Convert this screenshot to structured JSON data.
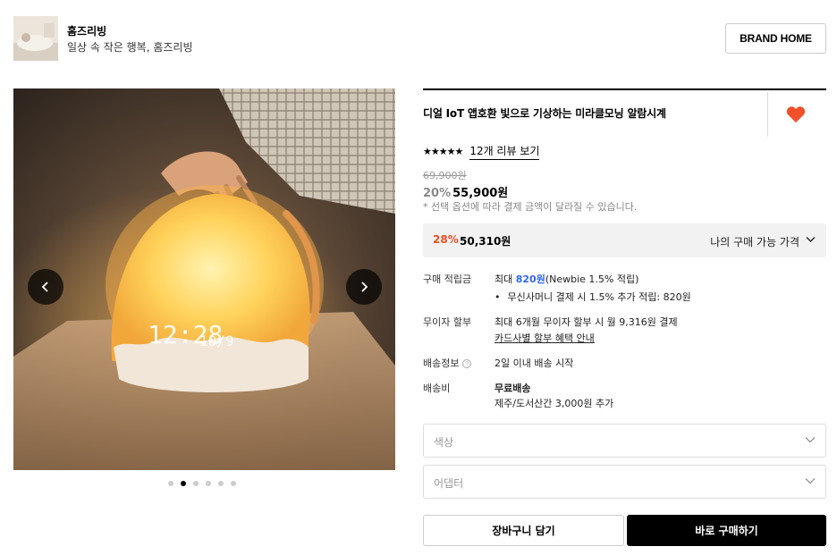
{
  "brand": {
    "name": "홈즈리빙",
    "slogan": "일상 속 작은 행복, 홈즈리빙",
    "home_button": "BRAND HOME"
  },
  "gallery": {
    "clock_time": "12:28",
    "clock_date": "10/9",
    "dot_count": 6,
    "active_dot": 1
  },
  "product": {
    "title": "디얼 IoT 앱호환 빛으로 기상하는 미라클모닝 알람시계",
    "stars": "★★★★★",
    "review_link": "12개 리뷰 보기",
    "original_price": "69,900원",
    "discount": "20%",
    "price": "55,900원",
    "price_note": "* 선택 옵션에 따라 결제 금액이 달라질 수 있습니다."
  },
  "best_price": {
    "discount": "28%",
    "amount": "50,310원",
    "label": "나의 구매 가능 가격"
  },
  "details": {
    "points_label": "구매 적립금",
    "points_prefix": "최대",
    "points_amount": "820원",
    "points_suffix": "(Newbie 1.5% 적립)",
    "points_extra": "무신사머니 결제 시 1.5% 추가 적립: 820원",
    "installment_label": "무이자 할부",
    "installment_text": "최대 6개월 무이자 할부 시 월 9,316원 결제",
    "installment_link": "카드사별 할부 혜택 안내",
    "shipping_label": "배송정보",
    "shipping_text": "2일 이내 배송 시작",
    "fee_label": "배송비",
    "fee_text": "무료배송",
    "fee_extra": "제주/도서산간 3,000원 추가"
  },
  "options": {
    "color_placeholder": "색상",
    "adapter_placeholder": "어댑터"
  },
  "actions": {
    "cart": "장바구니 담기",
    "buy": "바로 구매하기"
  },
  "colors": {
    "heart": "#f0502a",
    "discount_red": "#f0502a",
    "points_blue": "#2f66f3",
    "buy_bg": "#000000"
  }
}
